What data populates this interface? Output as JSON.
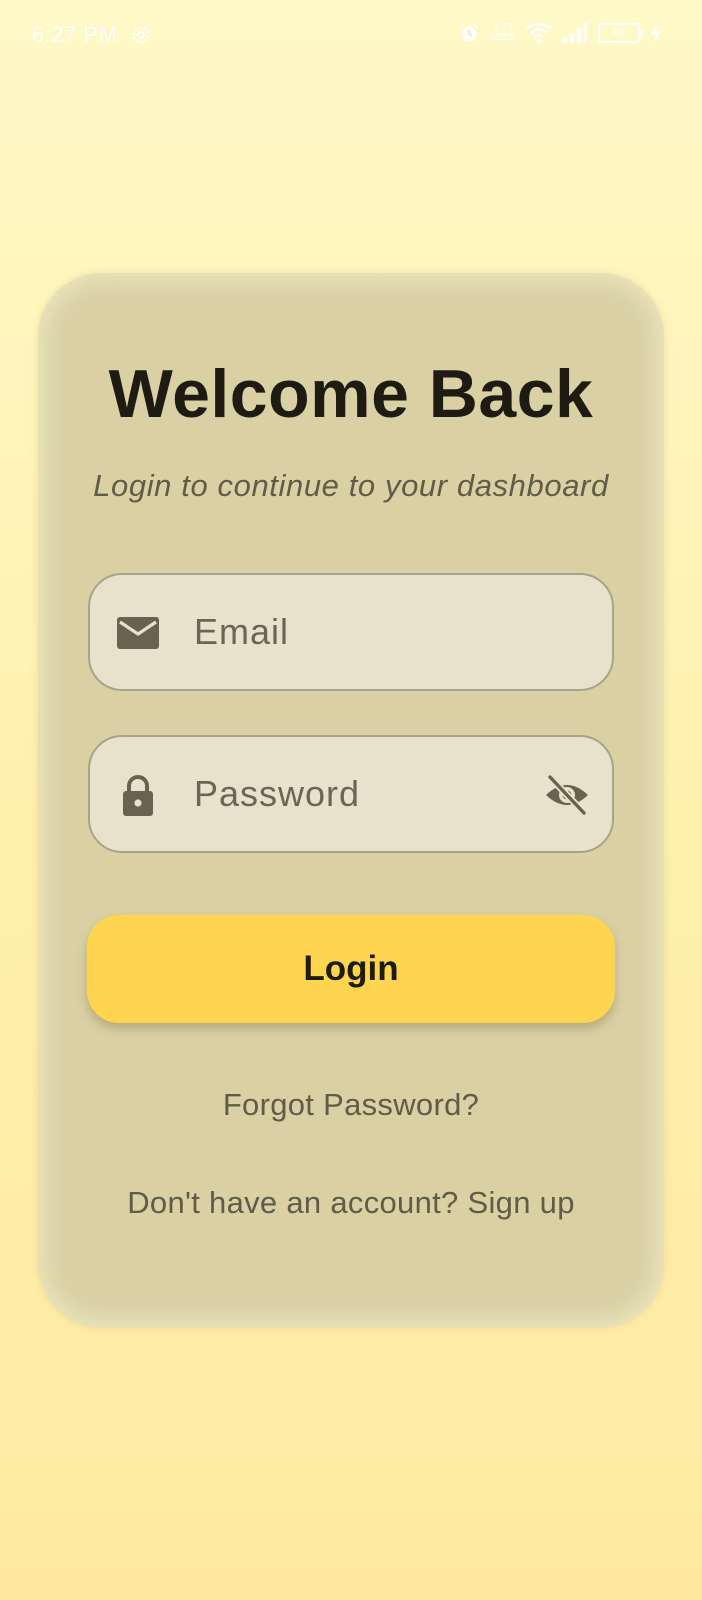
{
  "status_bar": {
    "time": "6:27 PM",
    "net_speed_value": "1.73",
    "net_speed_unit": "MB/S",
    "battery_level": "89"
  },
  "login": {
    "title": "Welcome Back",
    "subtitle": "Login to continue to your dashboard",
    "email_placeholder": "Email",
    "password_placeholder": "Password",
    "login_button": "Login",
    "forgot_password": "Forgot Password?",
    "signup_prompt": "Don't have an account?",
    "signup_link": "Sign up"
  },
  "colors": {
    "background_top": "#fff9c8",
    "background_bottom": "#ffeaa0",
    "card": "#d9d1a4",
    "field": "#e8e2cd",
    "accent": "#ffd54f",
    "text_dark": "#1d1b12",
    "text_muted": "#615c48"
  },
  "icons": {
    "status_gear": "gear-icon",
    "alarm": "alarm-icon",
    "wifi": "wifi-icon",
    "signal": "signal-icon",
    "charging": "charging-icon",
    "email_field": "mail-icon",
    "password_field": "lock-icon",
    "password_toggle": "eye-off-icon"
  }
}
